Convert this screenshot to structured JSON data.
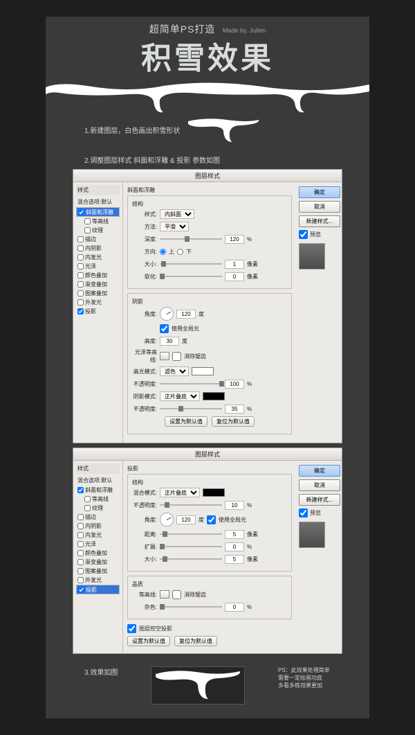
{
  "header": {
    "sub": "超简单PS打造",
    "madeby": "Made by. Julien",
    "main": "积雪效果"
  },
  "steps": {
    "s1": "1.新建图层，白色画出积雪形状",
    "s2": "2.调整图层样式  斜面和浮雕  &  投影  参数如图",
    "s3": "3.效果如图"
  },
  "dialog_title": "图层样式",
  "sidebar": {
    "head": "样式",
    "blend_label": "混合选项:默认",
    "items": [
      "斜面和浮雕",
      "等高线",
      "纹理",
      "描边",
      "内阴影",
      "内发光",
      "光泽",
      "颜色叠加",
      "渐变叠加",
      "图案叠加",
      "外发光",
      "投影"
    ]
  },
  "buttons": {
    "ok": "确定",
    "cancel": "取消",
    "new_style": "新建样式...",
    "preview": "预览"
  },
  "bevel": {
    "section": "斜面和浮雕",
    "struct": "结构",
    "labels": {
      "style": "样式:",
      "tech": "方法:",
      "depth": "深度:",
      "dir": "方向:",
      "size": "大小:",
      "soft": "软化:"
    },
    "style_val": "内斜面",
    "tech_val": "平滑",
    "depth_val": "120",
    "depth_unit": "%",
    "dir_up": "上",
    "dir_down": "下",
    "size_val": "1",
    "size_unit": "像素",
    "soft_val": "0",
    "soft_unit": "像素",
    "shade": "阴影",
    "shade_labels": {
      "angle": "角度:",
      "alt": "高度:",
      "gloss": "光泽等高线:",
      "hbox": "消除锯齿",
      "hl_mode": "高光模式:",
      "hl_op": "不透明度:",
      "sh_mode": "阴影模式:",
      "sh_op": "不透明度:",
      "use_global": "使用全局光"
    },
    "angle_val": "120",
    "angle_unit": "度",
    "alt_val": "30",
    "alt_unit": "度",
    "hl_mode_val": "滤色",
    "hl_op_val": "100",
    "hl_unit": "%",
    "sh_mode_val": "正片叠底",
    "sh_op_val": "35",
    "sh_unit": "%",
    "btn_default": "设置为默认值",
    "btn_reset": "复位为默认值"
  },
  "shadow": {
    "section": "投影",
    "struct": "结构",
    "labels": {
      "mode": "混合模式:",
      "op": "不透明度:",
      "angle": "角度:",
      "use_global": "使用全局光",
      "dist": "距离:",
      "spread": "扩展:",
      "size": "大小:"
    },
    "mode_val": "正片叠底",
    "op_val": "10",
    "op_unit": "%",
    "angle_val": "120",
    "angle_unit": "度",
    "dist_val": "5",
    "dist_unit": "像素",
    "spread_val": "0",
    "spread_unit": "%",
    "size_val": "5",
    "size_unit": "像素",
    "quality": "品质",
    "q_labels": {
      "contour": "等高线:",
      "anti": "消除锯齿",
      "noise": "杂色:"
    },
    "noise_val": "0",
    "noise_unit": "%",
    "knockout": "图层挖空投影",
    "btn_default": "设置为默认值",
    "btn_reset": "复位为默认值"
  },
  "ps_note": {
    "l1": "PS：此效果处理简单",
    "l2": "需要一定绘画功底",
    "l3": "多看多练效果更加"
  }
}
